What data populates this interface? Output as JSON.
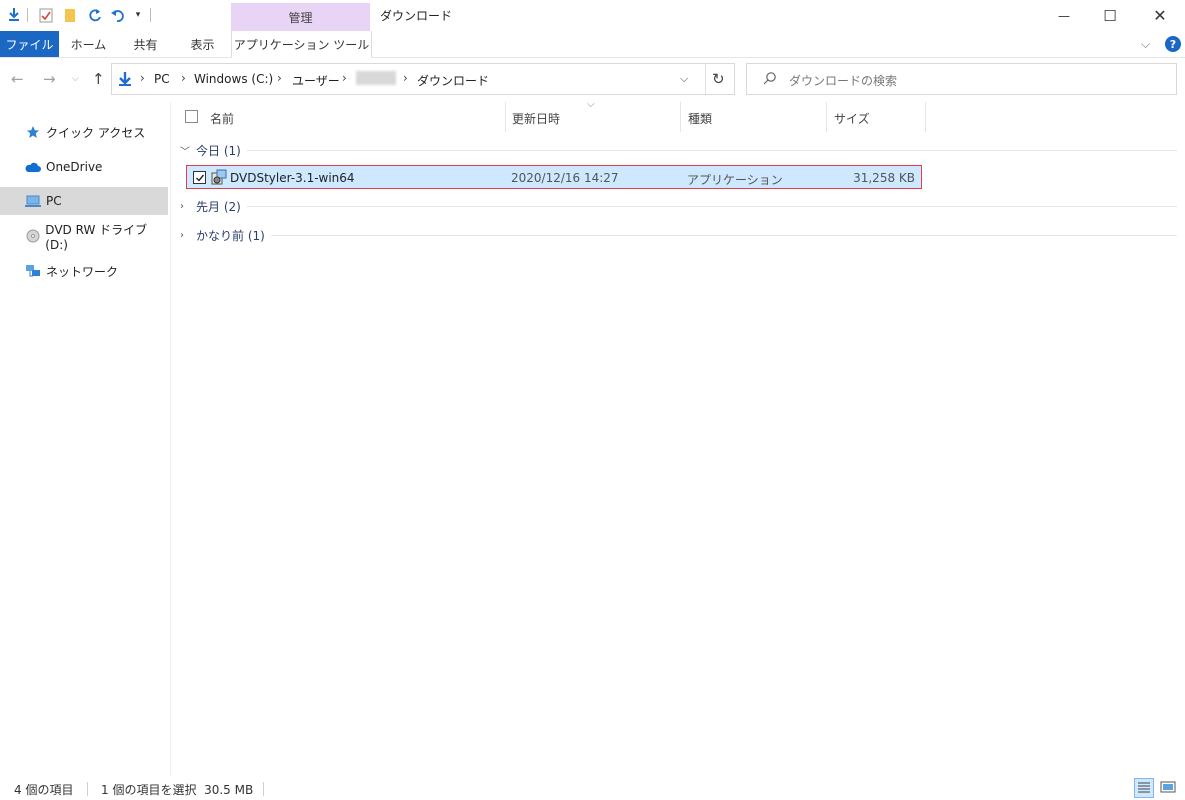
{
  "quick_access": {
    "icons": [
      "properties-icon",
      "check-icon",
      "folder-icon",
      "redo-icon",
      "undo-icon",
      "customize-icon"
    ]
  },
  "title_bar": {
    "manage_tab": "管理",
    "window_title": "ダウンロード",
    "minimize_symbol": "—",
    "maximize_symbol": "☐",
    "close_symbol": "✕"
  },
  "ribbon": {
    "tabs": [
      "ファイル",
      "ホーム",
      "共有",
      "表示",
      "アプリケーション ツール"
    ],
    "help_symbol": "?"
  },
  "address": {
    "crumbs": [
      "PC",
      "Windows (C:)",
      "ユーザー",
      "ダウンロード"
    ],
    "search_placeholder": "ダウンロードの検索"
  },
  "sidebar": {
    "items": [
      {
        "label": "クイック アクセス",
        "icon": "star-icon"
      },
      {
        "label": "OneDrive",
        "icon": "cloud-icon"
      },
      {
        "label": "PC",
        "icon": "computer-icon"
      },
      {
        "label": "DVD RW ドライブ (D:)",
        "icon": "disc-icon"
      },
      {
        "label": "ネットワーク",
        "icon": "network-icon"
      }
    ]
  },
  "columns": {
    "name": "名前",
    "modified": "更新日時",
    "type": "種類",
    "size": "サイズ"
  },
  "groups": [
    {
      "label": "今日 (1)",
      "expanded": true
    },
    {
      "label": "先月 (2)",
      "expanded": false
    },
    {
      "label": "かなり前 (1)",
      "expanded": false
    }
  ],
  "files": [
    {
      "name": "DVDStyler-3.1-win64",
      "modified": "2020/12/16 14:27",
      "type": "アプリケーション",
      "size": "31,258 KB",
      "selected": true
    }
  ],
  "status": {
    "count": "4 個の項目",
    "selection": "1 個の項目を選択  30.5 MB"
  },
  "colors": {
    "file_tab": "#1a67c4",
    "manage_tab": "#e8d4f5",
    "selection": "#cde8ff",
    "highlight_border": "#e03c49"
  }
}
